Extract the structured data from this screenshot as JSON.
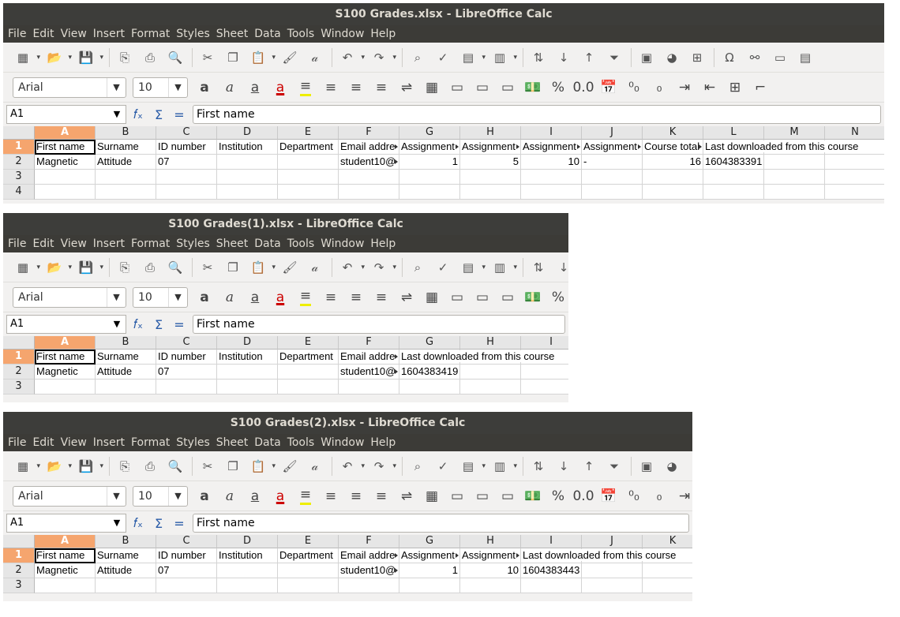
{
  "menu": [
    "File",
    "Edit",
    "View",
    "Insert",
    "Format",
    "Styles",
    "Sheet",
    "Data",
    "Tools",
    "Window",
    "Help"
  ],
  "font_name": "Arial",
  "font_size": "10",
  "name_box": "A1",
  "formula_content": "First name",
  "toolbar_icons": [
    "new-icon",
    "open-icon",
    "save-icon",
    "export-pdf-icon",
    "print-icon",
    "print-preview-icon",
    "cut-icon",
    "copy-icon",
    "paste-icon",
    "clone-format-icon",
    "clear-format-icon",
    "undo-icon",
    "redo-icon",
    "find-replace-icon",
    "spellcheck-icon",
    "row-icon",
    "column-icon",
    "sort-icon",
    "sort-ascending-icon",
    "sort-descending-icon",
    "autofilter-icon",
    "image-icon",
    "chart-icon",
    "pivot-table-icon",
    "special-character-icon",
    "hyperlink-icon",
    "comment-icon",
    "headers-footers-icon"
  ],
  "windows": [
    {
      "title": "S100 Grades.xlsx - LibreOffice Calc",
      "columns": [
        "A",
        "B",
        "C",
        "D",
        "E",
        "F",
        "G",
        "H",
        "I",
        "J",
        "K",
        "L",
        "M",
        "N"
      ],
      "rows": [
        {
          "num": "1",
          "cells": [
            "First name",
            "Surname",
            "ID number",
            "Institution",
            "Department",
            "Email addre",
            "Assignment",
            "Assignment",
            "Assignment",
            "Assignment",
            "Course total",
            "Last downloaded from this course",
            "",
            ""
          ]
        },
        {
          "num": "2",
          "cells": [
            "Magnetic",
            "Attitude",
            "07",
            "",
            "",
            "student10@",
            "1",
            "5",
            "10",
            "-",
            "16",
            "1604383391",
            "",
            ""
          ]
        },
        {
          "num": "3",
          "cells": [
            "",
            "",
            "",
            "",
            "",
            "",
            "",
            "",
            "",
            "",
            "",
            "",
            "",
            ""
          ]
        },
        {
          "num": "4",
          "cells": [
            "",
            "",
            "",
            "",
            "",
            "",
            "",
            "",
            "",
            "",
            "",
            "",
            "",
            ""
          ]
        }
      ]
    },
    {
      "title": "S100 Grades(1).xlsx - LibreOffice Calc",
      "columns": [
        "A",
        "B",
        "C",
        "D",
        "E",
        "F",
        "G",
        "H",
        "I"
      ],
      "rows": [
        {
          "num": "1",
          "cells": [
            "First name",
            "Surname",
            "ID number",
            "Institution",
            "Department",
            "Email addre",
            "Last downloaded from this course",
            "",
            ""
          ]
        },
        {
          "num": "2",
          "cells": [
            "Magnetic",
            "Attitude",
            "07",
            "",
            "",
            "student10@",
            "1604383419",
            "",
            ""
          ]
        },
        {
          "num": "3",
          "cells": [
            "",
            "",
            "",
            "",
            "",
            "",
            "",
            "",
            ""
          ]
        }
      ]
    },
    {
      "title": "S100 Grades(2).xlsx - LibreOffice Calc",
      "columns": [
        "A",
        "B",
        "C",
        "D",
        "E",
        "F",
        "G",
        "H",
        "I",
        "J",
        "K"
      ],
      "rows": [
        {
          "num": "1",
          "cells": [
            "First name",
            "Surname",
            "ID number",
            "Institution",
            "Department",
            "Email addre",
            "Assignment",
            "Assignment",
            "Last downloaded from this course",
            "",
            ""
          ]
        },
        {
          "num": "2",
          "cells": [
            "Magnetic",
            "Attitude",
            "07",
            "",
            "",
            "student10@",
            "1",
            "10",
            "1604383443",
            "",
            ""
          ]
        },
        {
          "num": "3",
          "cells": [
            "",
            "",
            "",
            "",
            "",
            "",
            "",
            "",
            "",
            "",
            ""
          ]
        }
      ]
    }
  ]
}
